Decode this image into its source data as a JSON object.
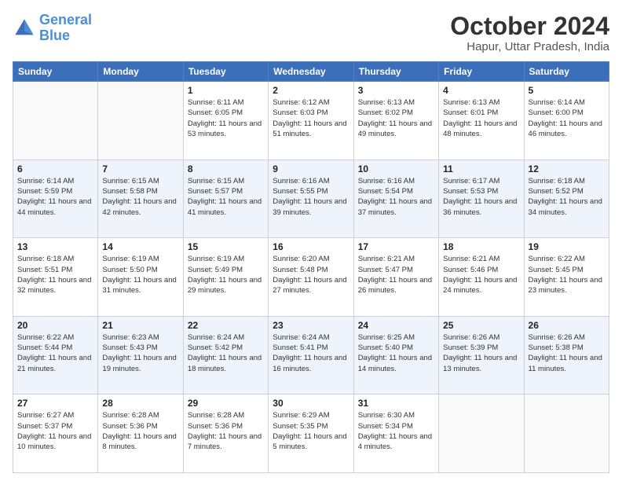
{
  "header": {
    "logo_line1": "General",
    "logo_line2": "Blue",
    "month_year": "October 2024",
    "location": "Hapur, Uttar Pradesh, India"
  },
  "days_of_week": [
    "Sunday",
    "Monday",
    "Tuesday",
    "Wednesday",
    "Thursday",
    "Friday",
    "Saturday"
  ],
  "weeks": [
    [
      {
        "day": "",
        "sunrise": "",
        "sunset": "",
        "daylight": ""
      },
      {
        "day": "",
        "sunrise": "",
        "sunset": "",
        "daylight": ""
      },
      {
        "day": "1",
        "sunrise": "Sunrise: 6:11 AM",
        "sunset": "Sunset: 6:05 PM",
        "daylight": "Daylight: 11 hours and 53 minutes."
      },
      {
        "day": "2",
        "sunrise": "Sunrise: 6:12 AM",
        "sunset": "Sunset: 6:03 PM",
        "daylight": "Daylight: 11 hours and 51 minutes."
      },
      {
        "day": "3",
        "sunrise": "Sunrise: 6:13 AM",
        "sunset": "Sunset: 6:02 PM",
        "daylight": "Daylight: 11 hours and 49 minutes."
      },
      {
        "day": "4",
        "sunrise": "Sunrise: 6:13 AM",
        "sunset": "Sunset: 6:01 PM",
        "daylight": "Daylight: 11 hours and 48 minutes."
      },
      {
        "day": "5",
        "sunrise": "Sunrise: 6:14 AM",
        "sunset": "Sunset: 6:00 PM",
        "daylight": "Daylight: 11 hours and 46 minutes."
      }
    ],
    [
      {
        "day": "6",
        "sunrise": "Sunrise: 6:14 AM",
        "sunset": "Sunset: 5:59 PM",
        "daylight": "Daylight: 11 hours and 44 minutes."
      },
      {
        "day": "7",
        "sunrise": "Sunrise: 6:15 AM",
        "sunset": "Sunset: 5:58 PM",
        "daylight": "Daylight: 11 hours and 42 minutes."
      },
      {
        "day": "8",
        "sunrise": "Sunrise: 6:15 AM",
        "sunset": "Sunset: 5:57 PM",
        "daylight": "Daylight: 11 hours and 41 minutes."
      },
      {
        "day": "9",
        "sunrise": "Sunrise: 6:16 AM",
        "sunset": "Sunset: 5:55 PM",
        "daylight": "Daylight: 11 hours and 39 minutes."
      },
      {
        "day": "10",
        "sunrise": "Sunrise: 6:16 AM",
        "sunset": "Sunset: 5:54 PM",
        "daylight": "Daylight: 11 hours and 37 minutes."
      },
      {
        "day": "11",
        "sunrise": "Sunrise: 6:17 AM",
        "sunset": "Sunset: 5:53 PM",
        "daylight": "Daylight: 11 hours and 36 minutes."
      },
      {
        "day": "12",
        "sunrise": "Sunrise: 6:18 AM",
        "sunset": "Sunset: 5:52 PM",
        "daylight": "Daylight: 11 hours and 34 minutes."
      }
    ],
    [
      {
        "day": "13",
        "sunrise": "Sunrise: 6:18 AM",
        "sunset": "Sunset: 5:51 PM",
        "daylight": "Daylight: 11 hours and 32 minutes."
      },
      {
        "day": "14",
        "sunrise": "Sunrise: 6:19 AM",
        "sunset": "Sunset: 5:50 PM",
        "daylight": "Daylight: 11 hours and 31 minutes."
      },
      {
        "day": "15",
        "sunrise": "Sunrise: 6:19 AM",
        "sunset": "Sunset: 5:49 PM",
        "daylight": "Daylight: 11 hours and 29 minutes."
      },
      {
        "day": "16",
        "sunrise": "Sunrise: 6:20 AM",
        "sunset": "Sunset: 5:48 PM",
        "daylight": "Daylight: 11 hours and 27 minutes."
      },
      {
        "day": "17",
        "sunrise": "Sunrise: 6:21 AM",
        "sunset": "Sunset: 5:47 PM",
        "daylight": "Daylight: 11 hours and 26 minutes."
      },
      {
        "day": "18",
        "sunrise": "Sunrise: 6:21 AM",
        "sunset": "Sunset: 5:46 PM",
        "daylight": "Daylight: 11 hours and 24 minutes."
      },
      {
        "day": "19",
        "sunrise": "Sunrise: 6:22 AM",
        "sunset": "Sunset: 5:45 PM",
        "daylight": "Daylight: 11 hours and 23 minutes."
      }
    ],
    [
      {
        "day": "20",
        "sunrise": "Sunrise: 6:22 AM",
        "sunset": "Sunset: 5:44 PM",
        "daylight": "Daylight: 11 hours and 21 minutes."
      },
      {
        "day": "21",
        "sunrise": "Sunrise: 6:23 AM",
        "sunset": "Sunset: 5:43 PM",
        "daylight": "Daylight: 11 hours and 19 minutes."
      },
      {
        "day": "22",
        "sunrise": "Sunrise: 6:24 AM",
        "sunset": "Sunset: 5:42 PM",
        "daylight": "Daylight: 11 hours and 18 minutes."
      },
      {
        "day": "23",
        "sunrise": "Sunrise: 6:24 AM",
        "sunset": "Sunset: 5:41 PM",
        "daylight": "Daylight: 11 hours and 16 minutes."
      },
      {
        "day": "24",
        "sunrise": "Sunrise: 6:25 AM",
        "sunset": "Sunset: 5:40 PM",
        "daylight": "Daylight: 11 hours and 14 minutes."
      },
      {
        "day": "25",
        "sunrise": "Sunrise: 6:26 AM",
        "sunset": "Sunset: 5:39 PM",
        "daylight": "Daylight: 11 hours and 13 minutes."
      },
      {
        "day": "26",
        "sunrise": "Sunrise: 6:26 AM",
        "sunset": "Sunset: 5:38 PM",
        "daylight": "Daylight: 11 hours and 11 minutes."
      }
    ],
    [
      {
        "day": "27",
        "sunrise": "Sunrise: 6:27 AM",
        "sunset": "Sunset: 5:37 PM",
        "daylight": "Daylight: 11 hours and 10 minutes."
      },
      {
        "day": "28",
        "sunrise": "Sunrise: 6:28 AM",
        "sunset": "Sunset: 5:36 PM",
        "daylight": "Daylight: 11 hours and 8 minutes."
      },
      {
        "day": "29",
        "sunrise": "Sunrise: 6:28 AM",
        "sunset": "Sunset: 5:36 PM",
        "daylight": "Daylight: 11 hours and 7 minutes."
      },
      {
        "day": "30",
        "sunrise": "Sunrise: 6:29 AM",
        "sunset": "Sunset: 5:35 PM",
        "daylight": "Daylight: 11 hours and 5 minutes."
      },
      {
        "day": "31",
        "sunrise": "Sunrise: 6:30 AM",
        "sunset": "Sunset: 5:34 PM",
        "daylight": "Daylight: 11 hours and 4 minutes."
      },
      {
        "day": "",
        "sunrise": "",
        "sunset": "",
        "daylight": ""
      },
      {
        "day": "",
        "sunrise": "",
        "sunset": "",
        "daylight": ""
      }
    ]
  ]
}
